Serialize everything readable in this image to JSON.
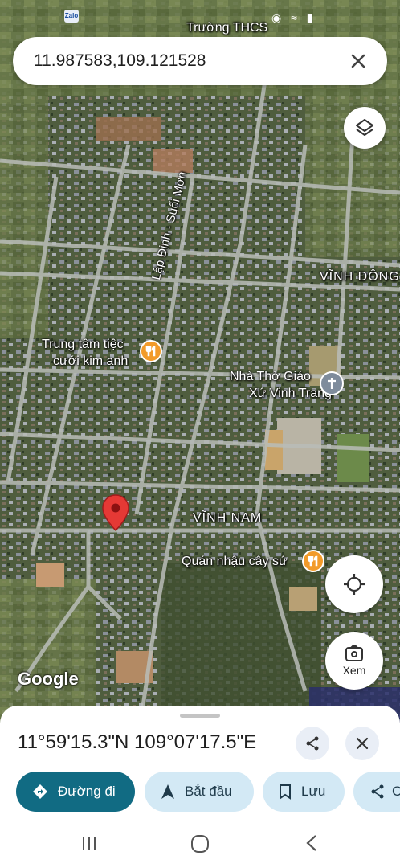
{
  "statusbar": {
    "app_badge": "Zalo",
    "icons": "◉ ≈ ▮"
  },
  "search": {
    "query": "11.987583,109.121528"
  },
  "map": {
    "labels": {
      "school": "Trường THCS",
      "vinh_dong": "VĨNH ĐÔNG",
      "road": "Lập Định - Suối Mơn",
      "wedding_line1": "Trung tâm tiệc",
      "wedding_line2": "cưới kim anh",
      "church_line1": "Nhà Thờ Giáo",
      "church_line2": "Xứ Vinh Trang",
      "vinh_nam": "VĨNH NAM",
      "pub": "Quán nhậu cây sứ"
    },
    "attribution": "Google",
    "colors": {
      "pin": "#e53935",
      "food_poi": "#f29b2a",
      "church_poi": "#7f8c9c"
    }
  },
  "controls": {
    "xem_label": "Xem"
  },
  "sheet": {
    "coordinates": "11°59'15.3\"N 109°07'17.5\"E",
    "chips": {
      "directions": "Đường đi",
      "start": "Bắt đầu",
      "save": "Lưu",
      "share": "C"
    },
    "accent": "#116b83"
  }
}
